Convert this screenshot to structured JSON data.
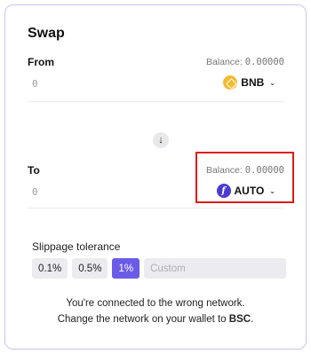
{
  "swap": {
    "title": "Swap"
  },
  "from": {
    "label": "From",
    "balance_prefix": "Balance: ",
    "balance_value": "0.00000",
    "amount_placeholder": "0",
    "token": {
      "symbol": "BNB",
      "icon": "bnb-token-icon"
    }
  },
  "switch": {
    "icon": "arrow-down-icon",
    "glyph": "↓"
  },
  "to": {
    "label": "To",
    "balance_prefix": "Balance: ",
    "balance_value": "0.00000",
    "amount_placeholder": "0",
    "token": {
      "symbol": "AUTO",
      "icon": "auto-token-icon",
      "glyph": "f"
    }
  },
  "slippage": {
    "label": "Slippage tolerance",
    "options": [
      "0.1%",
      "0.5%",
      "1%"
    ],
    "selected": "1%",
    "custom_placeholder": "Custom"
  },
  "message": {
    "line1": "You're connected to the wrong network.",
    "line2_prefix": "Change the network on your wallet to ",
    "network": "BSC",
    "line2_suffix": "."
  },
  "colors": {
    "accent": "#6b5ce7",
    "bnb": "#f3ba2f",
    "auto": "#4b3bd1",
    "highlight": "#e01a1a"
  }
}
